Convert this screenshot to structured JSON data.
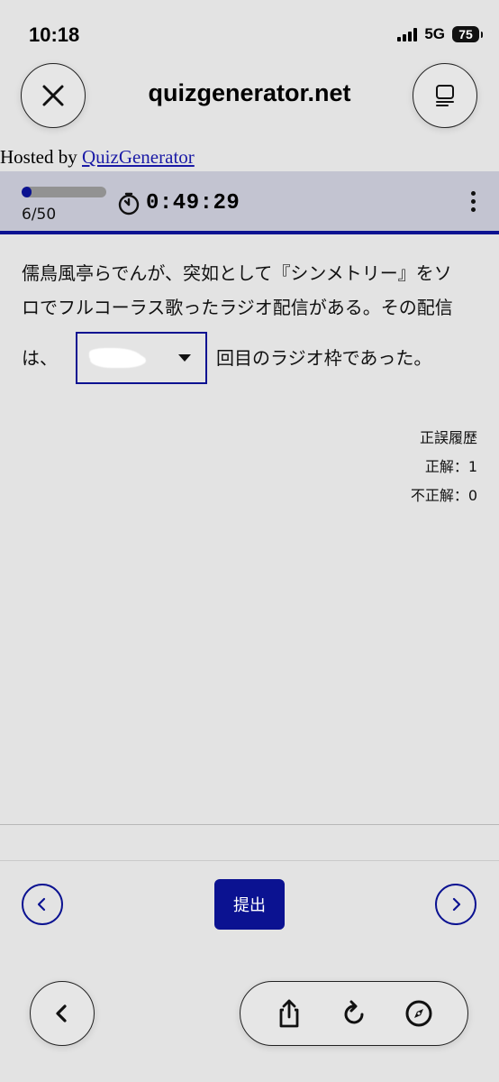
{
  "status_bar": {
    "time": "10:18",
    "network": "5G",
    "battery": "75"
  },
  "browser": {
    "site_title": "quizgenerator.net",
    "close_icon": "close-icon",
    "menu_icon": "tabs-menu-icon"
  },
  "hosted": {
    "prefix": "Hosted by",
    "link_text": "QuizGenerator"
  },
  "quiz_bar": {
    "progress_text": "6/50",
    "progress_fraction": 0.12,
    "timer": "0:49:29"
  },
  "question": {
    "line1": "儒鳥風亭らでんが、突如として『シンメトリー』をソ",
    "line2": "ロでフルコーラス歌ったラジオ配信がある。その配信",
    "line3_prefix": "は、",
    "line3_suffix": "回目のラジオ枠であった。"
  },
  "history": {
    "title": "正誤履歴",
    "correct": "正解：1",
    "incorrect": "不正解：0"
  },
  "quiz_nav": {
    "submit_label": "提出"
  },
  "colors": {
    "accent": "#0b1291",
    "background": "#e3e3e3",
    "quiz_bar": "#c3c4d1"
  }
}
